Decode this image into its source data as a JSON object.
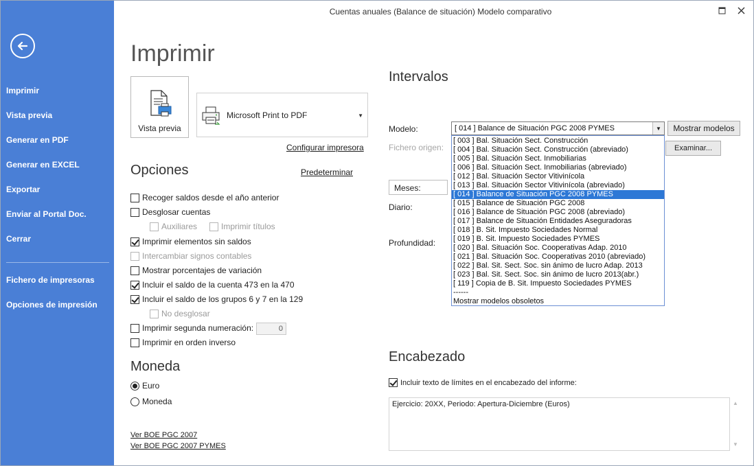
{
  "window": {
    "title": "Cuentas anuales (Balance de situación) Modelo comparativo"
  },
  "sidebar": {
    "items": [
      {
        "label": "Imprimir"
      },
      {
        "label": "Vista previa"
      },
      {
        "label": "Generar en PDF"
      },
      {
        "label": "Generar en EXCEL"
      },
      {
        "label": "Exportar"
      },
      {
        "label": "Enviar al Portal Doc."
      },
      {
        "label": "Cerrar"
      },
      {
        "label": "Fichero de impresoras"
      },
      {
        "label": "Opciones de impresión"
      }
    ]
  },
  "main": {
    "title": "Imprimir",
    "preview_tile_label": "Vista previa",
    "printer": "Microsoft Print to PDF",
    "configure_printer": "Configurar impresora",
    "default_link": "Predeterminar"
  },
  "opciones": {
    "title": "Opciones",
    "items": [
      {
        "label": "Recoger saldos desde el año anterior",
        "checked": false,
        "disabled": false
      },
      {
        "label": "Desglosar cuentas",
        "checked": false,
        "disabled": false
      },
      {
        "label": "Auxiliares",
        "checked": false,
        "disabled": true
      },
      {
        "label": "Imprimir títulos",
        "checked": false,
        "disabled": true
      },
      {
        "label": "Imprimir elementos sin saldos",
        "checked": true,
        "disabled": false
      },
      {
        "label": "Intercambiar signos contables",
        "checked": false,
        "disabled": true
      },
      {
        "label": "Mostrar porcentajes de variación",
        "checked": false,
        "disabled": false
      },
      {
        "label": "Incluir el saldo de la cuenta 473 en la 470",
        "checked": true,
        "disabled": false
      },
      {
        "label": "Incluir el saldo de los grupos 6 y 7 en la 129",
        "checked": true,
        "disabled": false
      },
      {
        "label": "No desglosar",
        "checked": false,
        "disabled": true
      },
      {
        "label": "Imprimir segunda numeración:",
        "checked": false,
        "disabled": false
      },
      {
        "label": "Imprimir en orden inverso",
        "checked": false,
        "disabled": false
      }
    ],
    "numeracion_value": "0"
  },
  "moneda": {
    "title": "Moneda",
    "options": [
      {
        "label": "Euro",
        "selected": true
      },
      {
        "label": "Moneda",
        "selected": false
      }
    ]
  },
  "links": {
    "boe": "Ver BOE PGC 2007",
    "boe_pymes": "Ver BOE PGC 2007 PYMES"
  },
  "intervalos": {
    "title": "Intervalos",
    "modelo_label": "Modelo:",
    "modelo_value": "[ 014 ] Balance de Situación PGC 2008 PYMES",
    "mostrar_modelos": "Mostrar modelos",
    "fichero_label": "Fichero origen:",
    "examinar": "Examinar...",
    "meses": "Meses:",
    "diario": "Diario:",
    "profundidad": "Profundidad:",
    "dropdown": [
      "[ 003 ] Bal. Situación Sect. Construcción",
      "[ 004 ] Bal. Situación Sect. Construcción (abreviado)",
      "[ 005 ] Bal. Situación Sect. Inmobiliarias",
      "[ 006 ] Bal. Situación Sect. Inmobiliarias (abreviado)",
      "[ 012 ] Bal. Situación Sector Vitivinícola",
      "[ 013 ] Bal. Situación Sector Vitivinícola (abreviado)",
      "[ 014 ] Balance de Situación PGC 2008 PYMES",
      "[ 015 ] Balance de Situación PGC 2008",
      "[ 016 ] Balance de Situación PGC 2008 (abreviado)",
      "[ 017 ] Balance de Situación Entidades Aseguradoras",
      "[ 018 ] B. Sit. Impuesto Sociedades Normal",
      "[ 019 ] B. Sit. Impuesto Sociedades PYMES",
      "[ 020 ] Bal. Situación Soc. Cooperativas Adap. 2010",
      "[ 021 ] Bal. Situación Soc. Cooperativas 2010 (abreviado)",
      "[ 022 ] Bal. Sit. Sect. Soc. sin ánimo de lucro Adap. 2013",
      "[ 023 ] Bal. Sit. Sect. Soc. sin ánimo de lucro 2013(abr.)",
      "[ 119 ] Copia de B. Sit. Impuesto Sociedades PYMES",
      "------",
      "Mostrar modelos obsoletos"
    ],
    "dropdown_selected": 6
  },
  "encabezado": {
    "title": "Encabezado",
    "include_label": "Incluir texto de límites en el encabezado del informe:",
    "include_checked": true,
    "text": "Ejercicio: 20XX, Periodo: Apertura-Diciembre (Euros)"
  },
  "colors": {
    "sidebar": "#4a7fd6",
    "selection": "#2d78d6"
  }
}
